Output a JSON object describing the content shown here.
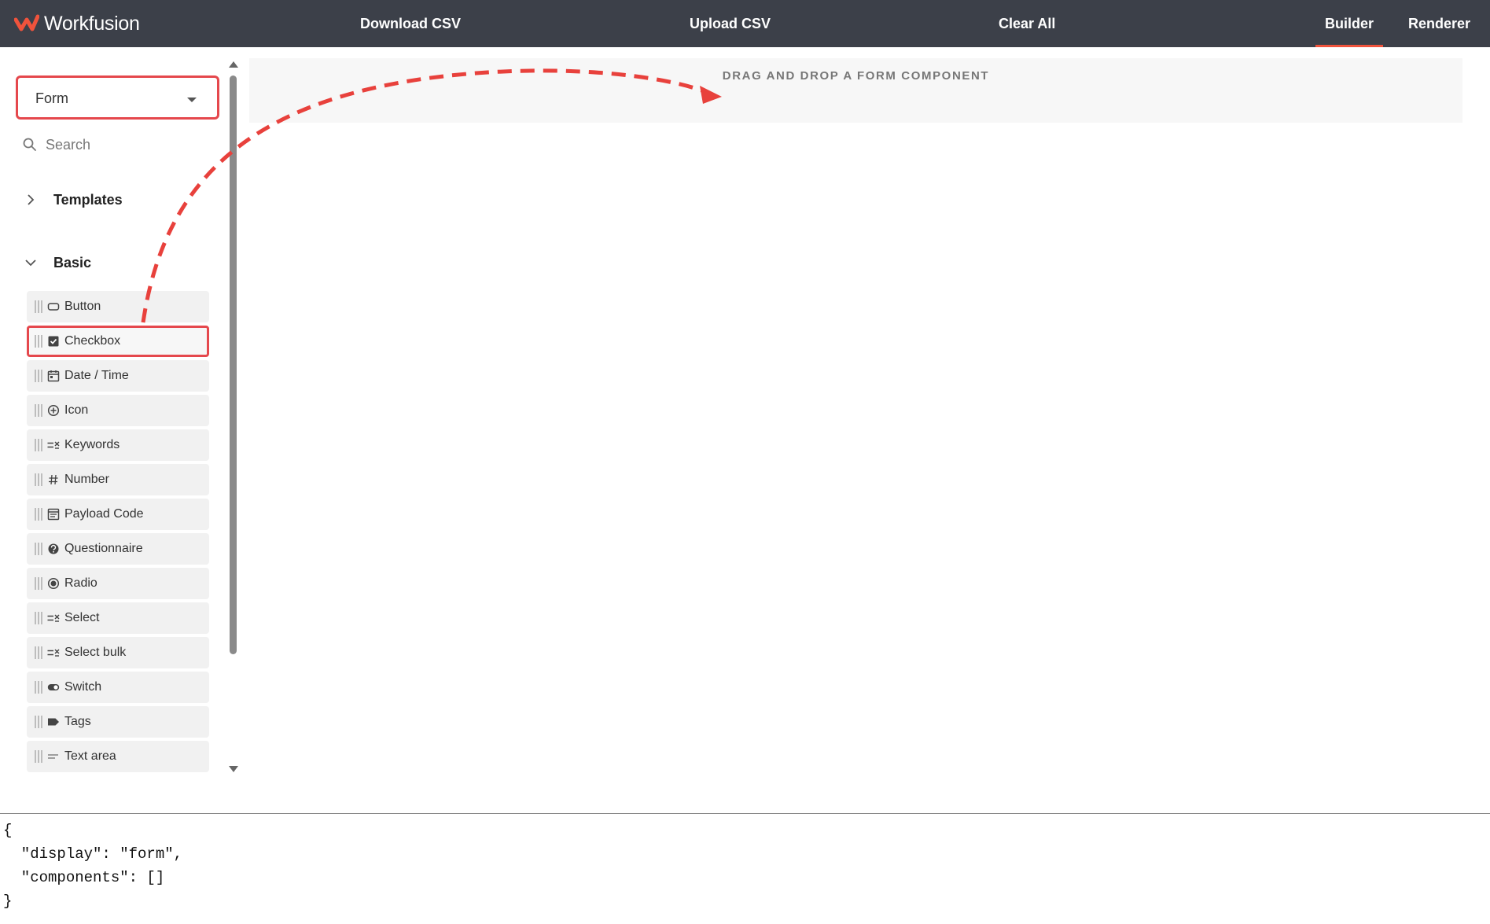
{
  "app": {
    "brand": "Workfusion",
    "colors": {
      "topbar": "#3c4049",
      "accent": "#f0533c",
      "highlight": "#e5484d",
      "arrow": "#e8413c"
    }
  },
  "nav": {
    "download_csv": "Download CSV",
    "upload_csv": "Upload CSV",
    "clear_all": "Clear All",
    "builder": "Builder",
    "renderer": "Renderer",
    "active_tab": "Builder"
  },
  "sidebar": {
    "display_select": {
      "value": "Form",
      "icon": "caret-down-icon"
    },
    "search": {
      "placeholder": "Search",
      "icon": "search-icon"
    },
    "groups": [
      {
        "label": "Templates",
        "expanded": false,
        "icon": "chevron-right-icon"
      },
      {
        "label": "Basic",
        "expanded": true,
        "icon": "chevron-down-icon"
      }
    ],
    "components": [
      {
        "label": "Button",
        "icon": "button-icon"
      },
      {
        "label": "Checkbox",
        "icon": "checkbox-icon"
      },
      {
        "label": "Date / Time",
        "icon": "calendar-icon"
      },
      {
        "label": "Icon",
        "icon": "plus-circle-icon"
      },
      {
        "label": "Keywords",
        "icon": "list-check-icon"
      },
      {
        "label": "Number",
        "icon": "hash-icon"
      },
      {
        "label": "Payload Code",
        "icon": "code-window-icon"
      },
      {
        "label": "Questionnaire",
        "icon": "question-circle-icon"
      },
      {
        "label": "Radio",
        "icon": "radio-icon"
      },
      {
        "label": "Select",
        "icon": "list-check-icon"
      },
      {
        "label": "Select bulk",
        "icon": "list-check-icon"
      },
      {
        "label": "Switch",
        "icon": "toggle-icon"
      },
      {
        "label": "Tags",
        "icon": "tag-icon"
      },
      {
        "label": "Text area",
        "icon": "text-lines-icon"
      }
    ],
    "highlighted_component": "Checkbox"
  },
  "dropzone": {
    "text": "DRAG AND DROP A FORM COMPONENT"
  },
  "json_output": "{\n  \"display\": \"form\",\n  \"components\": []\n}"
}
